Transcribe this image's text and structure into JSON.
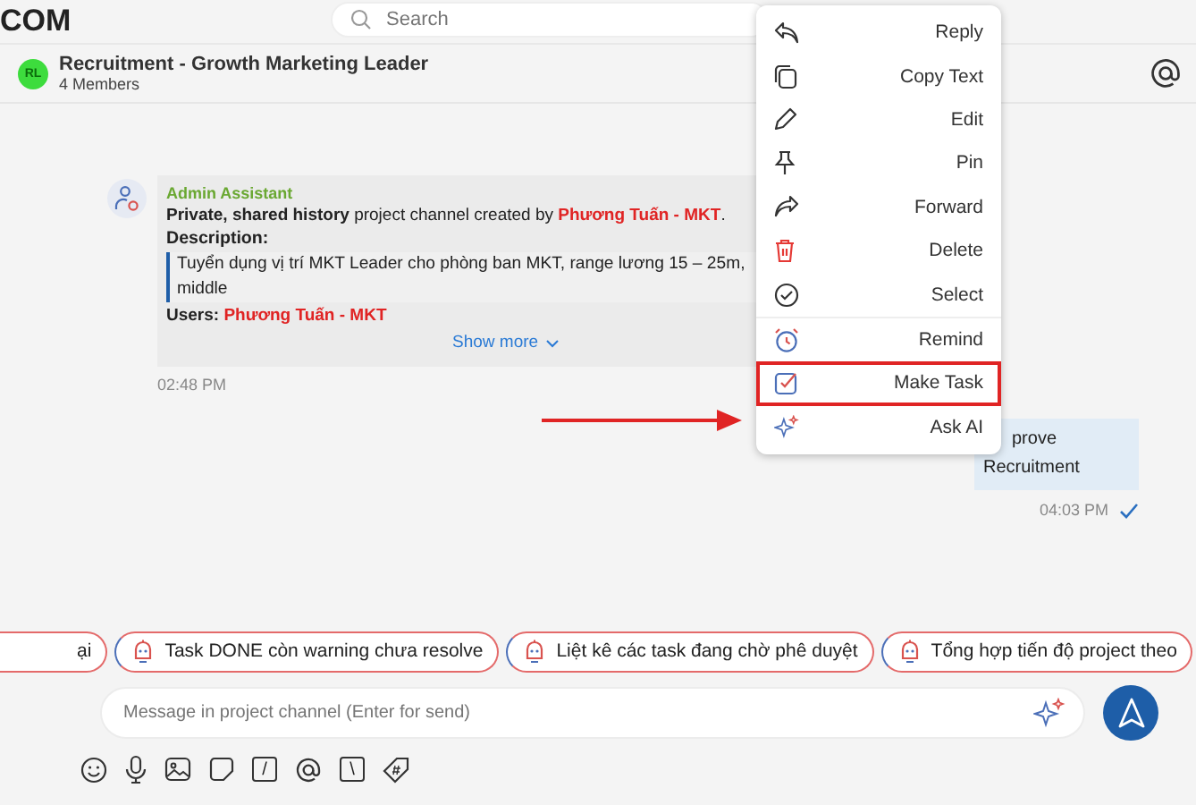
{
  "brand": "COM",
  "search": {
    "placeholder": "Search"
  },
  "channel": {
    "avatar": "RL",
    "title": "Recruitment - Growth Marketing Leader",
    "members": "4 Members"
  },
  "system_message": {
    "sender": "Admin Assistant",
    "intro": "**Private, shared history** project channel created by",
    "creator": "Phương Tuấn - MKT",
    "creator_end": ".",
    "description_label": "Description:",
    "description_lines": [
      "Tuyển dụng vị trí MKT Leader cho phòng ban MKT, range lương 15 – 25m,",
      "middle"
    ],
    "users_label": "Users:",
    "users": "Phương Tuấn - MKT",
    "show_more": "Show more",
    "time": "02:48 PM"
  },
  "my_message": {
    "lines": [
      "prove",
      "Recruitment"
    ],
    "time": "04:03 PM",
    "read": true
  },
  "context_menu": [
    {
      "kind": "reply",
      "label": "Reply",
      "divider_before": false,
      "highlighted": false
    },
    {
      "kind": "copy",
      "label": "Copy Text",
      "divider_before": false,
      "highlighted": false
    },
    {
      "kind": "edit",
      "label": "Edit",
      "divider_before": false,
      "highlighted": false
    },
    {
      "kind": "pin",
      "label": "Pin",
      "divider_before": false,
      "highlighted": false
    },
    {
      "kind": "forward",
      "label": "Forward",
      "divider_before": false,
      "highlighted": false
    },
    {
      "kind": "delete",
      "label": "Delete",
      "divider_before": false,
      "highlighted": false
    },
    {
      "kind": "select",
      "label": "Select",
      "divider_before": false,
      "highlighted": false
    },
    {
      "kind": "remind",
      "label": "Remind",
      "divider_before": true,
      "highlighted": false
    },
    {
      "kind": "task",
      "label": "Make Task",
      "divider_before": false,
      "highlighted": true
    },
    {
      "kind": "ai",
      "label": "Ask AI",
      "divider_before": false,
      "highlighted": false
    }
  ],
  "suggestions": [
    "ại",
    "Task DONE còn warning chưa resolve",
    "Liệt kê các task đang chờ phê duyệt",
    "Tổng hợp tiến độ project theo"
  ],
  "composer": {
    "placeholder": "Message in project channel (Enter for send)"
  },
  "toolbar": [
    {
      "kind": "emoji"
    },
    {
      "kind": "mic"
    },
    {
      "kind": "image"
    },
    {
      "kind": "sticker"
    },
    {
      "kind": "key",
      "label": "/"
    },
    {
      "kind": "at"
    },
    {
      "kind": "key",
      "label": "\\"
    },
    {
      "kind": "tag"
    }
  ]
}
